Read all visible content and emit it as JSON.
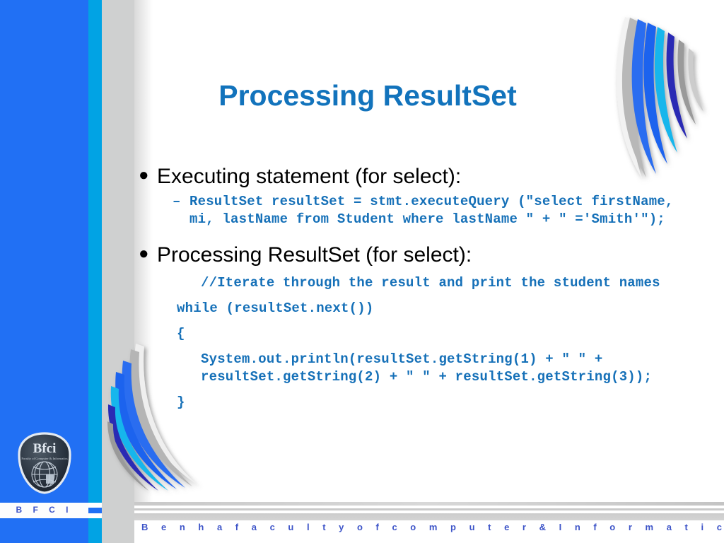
{
  "slide": {
    "title": "Processing ResultSet",
    "bullets": [
      {
        "label": "Executing statement (for select):",
        "sub_dash": "–",
        "code": "ResultSet resultSet = stmt.executeQuery  (\"select firstName, mi, lastName from Student where lastName \" + \" ='Smith'\");"
      },
      {
        "label": "Processing ResultSet (for select):",
        "code_lines": [
          "//Iterate through the result and print the student names",
          "while (resultSet.next())",
          "{",
          "System.out.println(resultSet.getString(1) + \" \" + resultSet.getString(2) + \" \" + resultSet.getString(3));",
          "}"
        ]
      }
    ]
  },
  "branding": {
    "logo_main_text": "Bfci",
    "logo_sub_text": "Faculty of Computer & Informatics",
    "sidebar_acronym": "B F C I",
    "footer_text": "B e n h a   f a c u l t y   o f   c o m p u t e r   &   I n f o r m a t i c s"
  },
  "colors": {
    "title_blue": "#1273bc",
    "code_blue": "#1570b8",
    "sidebar_royal": "#2170f4",
    "sidebar_cyan": "#01a3e4",
    "sidebar_gray": "#cfd0d0",
    "footer_blue": "#3d54c8",
    "body_text": "#000000"
  }
}
